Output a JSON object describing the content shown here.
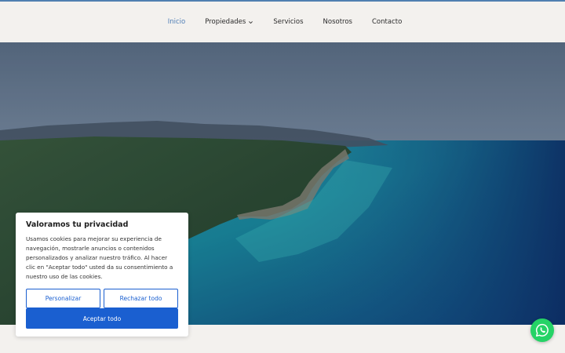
{
  "nav": {
    "items": [
      {
        "label": "Inicio",
        "active": true
      },
      {
        "label": "Propiedades",
        "has_dropdown": true
      },
      {
        "label": "Servicios"
      },
      {
        "label": "Nosotros"
      },
      {
        "label": "Contacto"
      }
    ]
  },
  "hero": {
    "image_subject": "aerial coastline with forest and turquoise sea"
  },
  "cookie_banner": {
    "title": "Valoramos tu privacidad",
    "text": "Usamos cookies para mejorar su experiencia de navegación, mostrarle anuncios o contenidos personalizados y analizar nuestro tráfico. Al hacer clic en \"Aceptar todo\" usted da su consentimiento a nuestro uso de las cookies.",
    "customize_label": "Personalizar",
    "reject_label": "Rechazar todo",
    "accept_label": "Aceptar todo"
  },
  "floating": {
    "icon": "whatsapp-icon"
  },
  "colors": {
    "accent": "#1a5fd0",
    "nav_active": "#4d7db5",
    "header_bg": "#f3f1ee",
    "whatsapp": "#25d366"
  }
}
